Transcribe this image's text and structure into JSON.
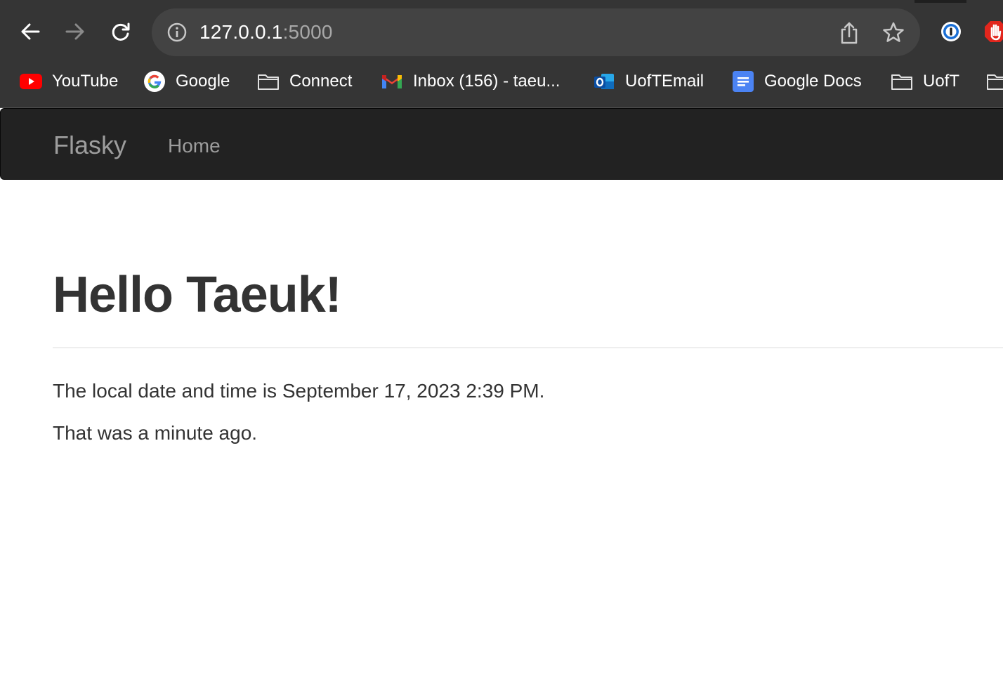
{
  "browser": {
    "url_host": "127.0.0.1",
    "url_port": ":5000",
    "icons": {
      "back": "arrow-left-icon",
      "forward": "arrow-right-icon",
      "reload": "reload-icon",
      "site_info": "info-icon",
      "share": "share-icon",
      "bookmark_star": "star-icon",
      "password_manager": "1password-icon",
      "adblock": "stop-hand-icon"
    },
    "bookmarks": [
      {
        "label": "YouTube",
        "icon": "youtube-icon"
      },
      {
        "label": "Google",
        "icon": "google-icon"
      },
      {
        "label": "Connect",
        "icon": "folder-icon"
      },
      {
        "label": "Inbox (156) - taeu...",
        "icon": "gmail-icon"
      },
      {
        "label": "UofTEmail",
        "icon": "outlook-icon"
      },
      {
        "label": "Google Docs",
        "icon": "google-docs-icon"
      },
      {
        "label": "UofT",
        "icon": "folder-icon"
      }
    ]
  },
  "navbar": {
    "brand": "Flasky",
    "links": [
      {
        "label": "Home"
      }
    ],
    "background": "#222222",
    "link_color": "#9d9d9d"
  },
  "page": {
    "heading": "Hello Taeuk!",
    "local_time_text": "The local date and time is September 17, 2023 2:39 PM.",
    "relative_time_text": "That was a minute ago.",
    "text_color": "#333333"
  }
}
